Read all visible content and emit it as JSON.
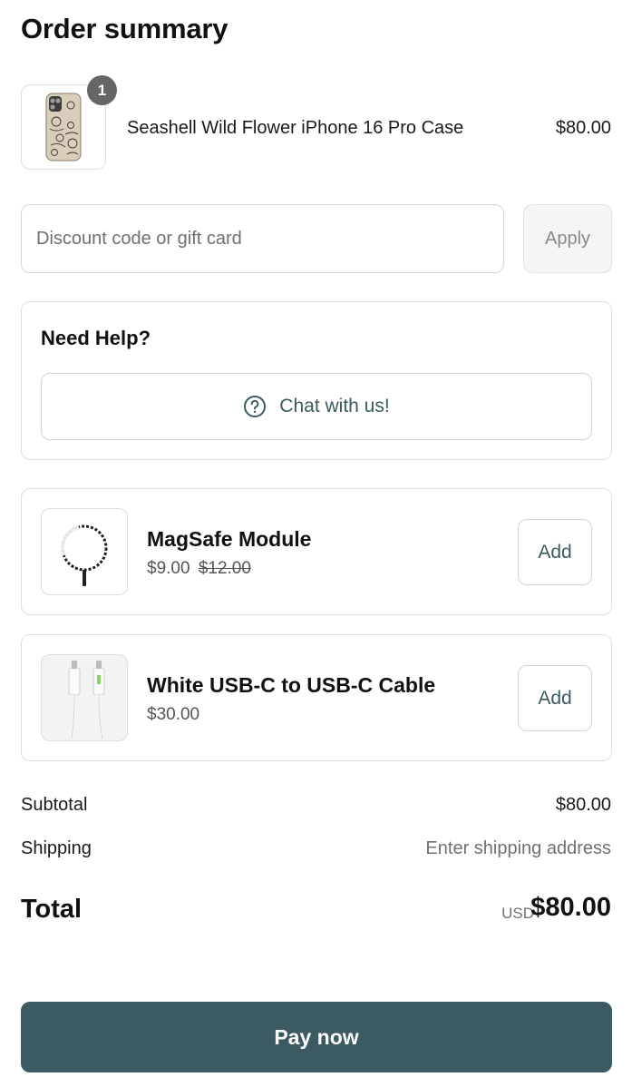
{
  "page": {
    "title": "Order summary"
  },
  "cart": {
    "item": {
      "name": "Seashell Wild Flower iPhone 16 Pro Case",
      "price": "$80.00",
      "quantity": "1",
      "image_icon": "floral-phone-case-icon"
    }
  },
  "discount": {
    "placeholder": "Discount code or gift card",
    "value": "",
    "apply_label": "Apply"
  },
  "help": {
    "title": "Need Help?",
    "chat_label": "Chat with us!",
    "chat_icon": "question-circle-icon"
  },
  "upsells": [
    {
      "name": "MagSafe Module",
      "price": "$9.00",
      "compare_price": "$12.00",
      "add_label": "Add",
      "image_icon": "magsafe-ring-icon"
    },
    {
      "name": "White USB-C to USB-C Cable",
      "price": "$30.00",
      "compare_price": "",
      "add_label": "Add",
      "image_icon": "usb-c-cable-icon"
    }
  ],
  "totals": {
    "subtotal_label": "Subtotal",
    "subtotal_value": "$80.00",
    "shipping_label": "Shipping",
    "shipping_value": "Enter shipping address",
    "total_label": "Total",
    "currency": "USD",
    "total_value": "$80.00"
  },
  "checkout": {
    "pay_label": "Pay now"
  },
  "colors": {
    "accent": "#3b5a62",
    "muted_text": "#707070",
    "border": "#dedede"
  }
}
